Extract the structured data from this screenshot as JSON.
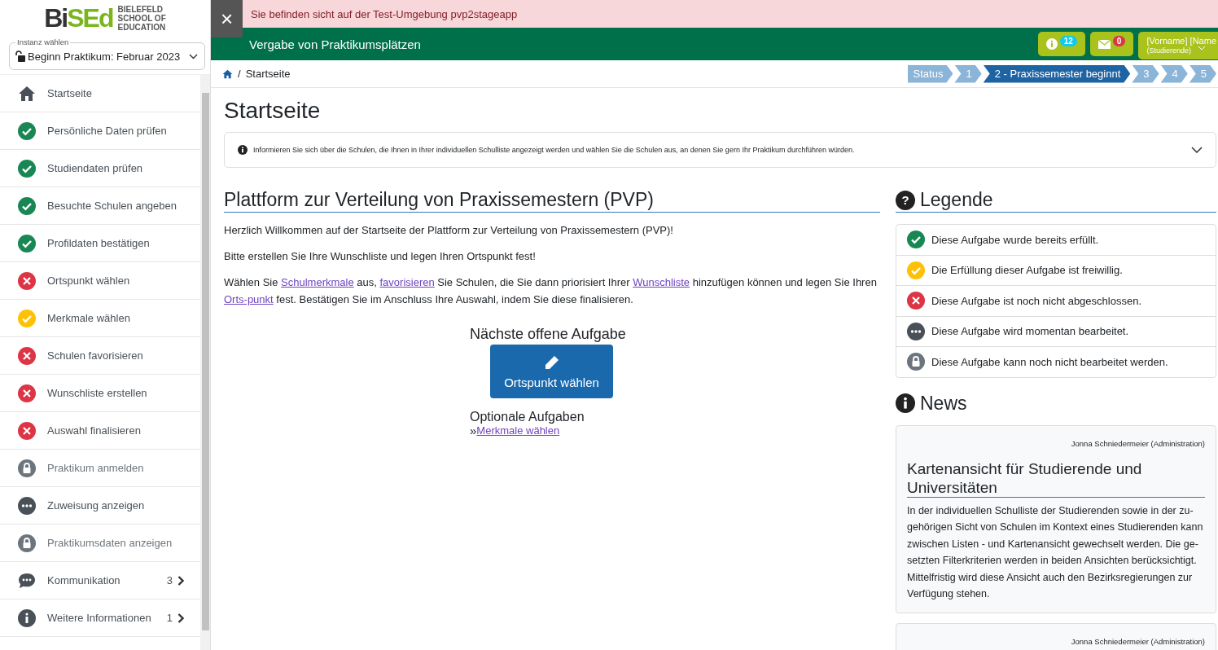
{
  "logo": {
    "mark_dark": "Bi",
    "mark_green": "SEd",
    "line_1": "BIELEFELD",
    "line_2": "SCHOOL OF",
    "line_3": "EDUCATION"
  },
  "instance_select": {
    "label": "Instanz wählen",
    "value": "Beginn Praktikum: Februar 2023"
  },
  "sidebar": {
    "items": [
      {
        "kind": "home",
        "label": "Startseite"
      },
      {
        "kind": "done",
        "label": "Persönliche Daten prüfen"
      },
      {
        "kind": "done",
        "label": "Studiendaten prüfen"
      },
      {
        "kind": "done",
        "label": "Besuchte Schulen angeben"
      },
      {
        "kind": "done",
        "label": "Profildaten bestätigen"
      },
      {
        "kind": "open",
        "label": "Ortspunkt wählen"
      },
      {
        "kind": "optional",
        "label": "Merkmale wählen"
      },
      {
        "kind": "open",
        "label": "Schulen favorisieren"
      },
      {
        "kind": "open",
        "label": "Wunschliste erstellen"
      },
      {
        "kind": "open",
        "label": "Auswahl finalisieren"
      },
      {
        "kind": "locked",
        "label": "Praktikum anmelden"
      },
      {
        "kind": "running",
        "label": "Zuweisung anzeigen"
      },
      {
        "kind": "locked",
        "label": "Praktikumsdaten anzeigen"
      },
      {
        "kind": "chat",
        "label": "Kommunikation",
        "count": "3"
      },
      {
        "kind": "info",
        "label": "Weitere Informationen",
        "count": "1"
      }
    ]
  },
  "banner": {
    "close": "×",
    "text": "Sie befinden sicht auf der Test-Umgebung pvp2stageapp"
  },
  "header": {
    "title": "Vergabe von Praktikumsplätzen",
    "info_count": "12",
    "mail_count": "0",
    "user_name": "[Vorname] [Name",
    "user_role": "(Studierende)"
  },
  "breadcrumb": {
    "separator": "/",
    "items": [
      "Startseite"
    ]
  },
  "steps": [
    {
      "label": "Status",
      "selected": false
    },
    {
      "label": "1",
      "selected": false
    },
    {
      "label": "2 - Praxissemester beginnt",
      "selected": true
    },
    {
      "label": "3",
      "selected": false
    },
    {
      "label": "4",
      "selected": false
    },
    {
      "label": "5",
      "selected": false
    }
  ],
  "page_title": "Startseite",
  "info_panel": {
    "text": "Informieren Sie sich über die Schulen, die Ihnen in Ihrer individuellen Schulliste angezeigt werden und wählen Sie die Schulen aus, an denen Sie gern Ihr Praktikum durchführen würden.",
    "expanded": false
  },
  "intro": {
    "heading": "Plattform zur Verteilung von Praxissemestern (PVP)",
    "paragraphs": [
      [
        {
          "text": "Herzlich Willkommen auf der Startseite der Plattform zur Verteilung von Praxissemestern (PVP)!"
        }
      ],
      [
        {
          "text": "Bitte erstellen Sie Ihre Wunschliste und legen Ihren Ortspunkt fest!"
        }
      ],
      [
        {
          "text": "Wählen Sie "
        },
        {
          "link": "Schulmerkmale"
        },
        {
          "text": " aus, "
        },
        {
          "link": "favorisieren"
        },
        {
          "text": " Sie Schulen, die Sie dann priorisiert Ihrer "
        },
        {
          "link": "Wunschliste"
        },
        {
          "text": " hinzufügen können und legen Sie Ihren "
        },
        {
          "link": "Orts-punkt"
        },
        {
          "text": " fest. Bestätigen Sie im Anschluss Ihre Auswahl, indem Sie diese finalisieren."
        }
      ]
    ]
  },
  "next_task": {
    "heading": "Nächste offene Aufgabe",
    "button": "Ortspunkt wählen",
    "optional_heading": "Optionale Aufgaben",
    "optional_marker": "»",
    "optional_links": [
      "Merkmale wählen"
    ]
  },
  "legend": {
    "icon": "?",
    "heading": "Legende",
    "items": [
      {
        "kind": "done",
        "text": "Diese Aufgabe wurde bereits erfüllt."
      },
      {
        "kind": "optional",
        "text": "Die Erfüllung dieser Aufgabe ist freiwillig."
      },
      {
        "kind": "open",
        "text": "Diese Aufgabe ist noch nicht abgeschlossen."
      },
      {
        "kind": "running",
        "text": "Diese Aufgabe wird momentan bearbeitet."
      },
      {
        "kind": "locked",
        "text": "Diese Aufgabe kann noch nicht bearbeitet werden."
      }
    ]
  },
  "news": {
    "heading": "News",
    "items": [
      {
        "author": "Jonna Schniedermeier (Administration)",
        "title": "Kartenansicht für Studierende und Universitäten",
        "body": "In der individuellen Schulliste der Studierenden sowie in der zu-gehörigen Sicht von Schulen im Kontext eines Studierenden kann zwischen Listen - und Kartenansicht gewechselt werden. Die ge-setzten Filterkriterien werden in beiden Ansichten berücksichtigt. Mittelfristig wird diese Ansicht auch den Bezirksregierungen zur Verfügung stehen."
      },
      {
        "author": "Jonna Schniedermeier (Administration)"
      }
    ]
  }
}
